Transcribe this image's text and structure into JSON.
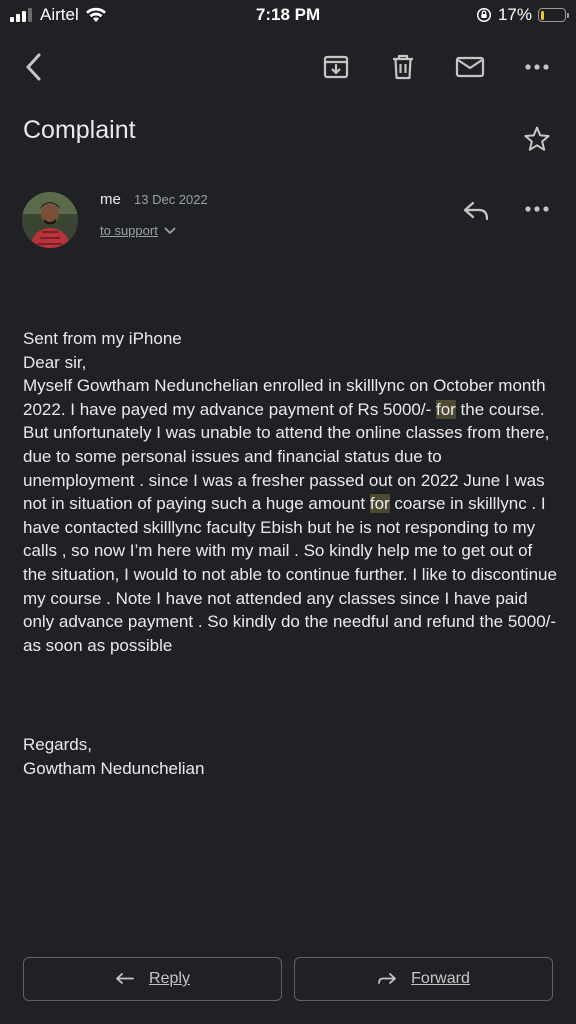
{
  "status_bar": {
    "carrier": "Airtel",
    "time": "7:18 PM",
    "battery": "17%",
    "battery_level": 0.17,
    "signal_bars_active": 3,
    "signal_bars_total": 4
  },
  "toolbar": {
    "icons": [
      "back-arrow-icon",
      "archive-icon",
      "trash-icon",
      "mail-icon",
      "more-icon"
    ]
  },
  "email": {
    "subject": "Complaint",
    "sender": "me",
    "date": "13 Dec 2022",
    "to": "to support",
    "body": {
      "l1": "Sent from my iPhone",
      "l2": "Dear sir,",
      "p1": "Myself Gowtham Nedunchelian enrolled in skilllync on October month 2022. I have payed my advance payment of Rs 5000/- ",
      "hl1": "for",
      "p2": " the course. But unfortunately I was unable to attend the online classes from there, due to some personal issues and financial status due to unemployment . since I was a fresher passed out on 2022 June I was not in situation of paying such a huge amount ",
      "hl2": "for",
      "p3": " coarse in skilllync . I have contacted skilllync faculty Ebish but he is not responding to my calls , so now I’m here with my mail . So kindly help me to get out of the situation, I would to not able to continue further. I like to discontinue my course . Note I have not attended any classes since I have paid only advance payment . So kindly do the needful and refund the 5000/- as soon as possible"
    },
    "regards": "Regards,",
    "signature": "Gowtham Nedunchelian"
  },
  "actions": {
    "reply": "Reply",
    "forward": "Forward"
  },
  "colors": {
    "background": "#202124",
    "text": "#e8eaed",
    "muted": "#9aa0a6",
    "highlight": "#4e4a30",
    "battery": "#f5c518"
  }
}
